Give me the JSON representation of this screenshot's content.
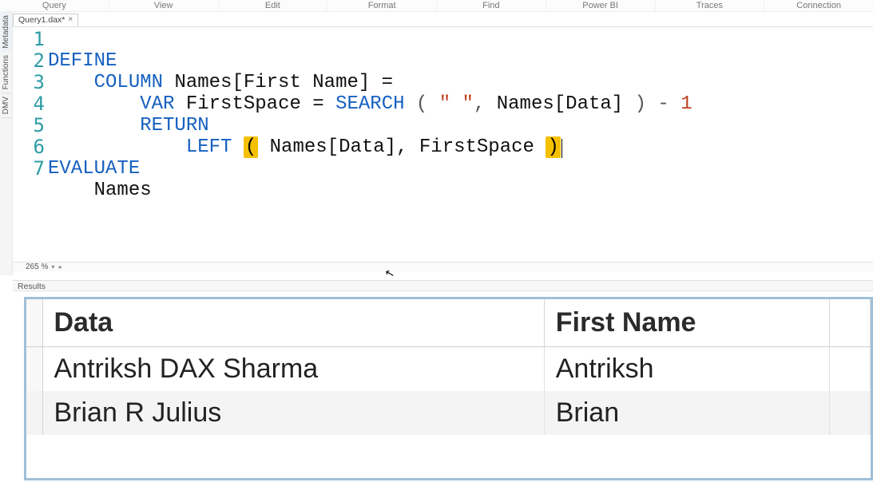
{
  "menu": {
    "items": [
      "Query",
      "View",
      "Edit",
      "Format",
      "Find",
      "Power BI",
      "Traces",
      "Connection"
    ]
  },
  "left_rail": {
    "tabs": [
      "Metadata",
      "Functions",
      "DMV"
    ]
  },
  "file_tab": {
    "label": "Query1.dax*",
    "close_glyph": "×"
  },
  "editor": {
    "line_numbers": [
      "1",
      "2",
      "3",
      "4",
      "5",
      "6",
      "7"
    ],
    "tokens": {
      "define": "DEFINE",
      "column": "COLUMN",
      "col_ref": "Names[First Name] =",
      "var": "VAR",
      "var_name": "FirstSpace =",
      "search_fn": "SEARCH",
      "search_args_open": "(",
      "search_str": "\" \"",
      "search_comma": ",",
      "search_col": "Names[Data]",
      "search_close": ")",
      "minus": "-",
      "one": "1",
      "return": "RETURN",
      "left_fn": "LEFT",
      "left_open": "(",
      "left_arg1": "Names[Data],",
      "left_arg2": "FirstSpace",
      "left_close": ")",
      "evaluate": "EVALUATE",
      "table": "Names"
    }
  },
  "zoom": {
    "value": "265 %",
    "chev_down": "▾",
    "chev_left": "◂"
  },
  "results": {
    "panel_label": "Results",
    "columns": [
      "Data",
      "First Name"
    ],
    "rows": [
      {
        "data": "Antriksh DAX Sharma",
        "first_name": "Antriksh"
      },
      {
        "data": "Brian R Julius",
        "first_name": "Brian"
      }
    ]
  },
  "chart_data": {
    "type": "table",
    "title": "Results",
    "columns": [
      "Data",
      "First Name"
    ],
    "rows": [
      [
        "Antriksh DAX Sharma",
        "Antriksh"
      ],
      [
        "Brian R Julius",
        "Brian"
      ]
    ]
  }
}
